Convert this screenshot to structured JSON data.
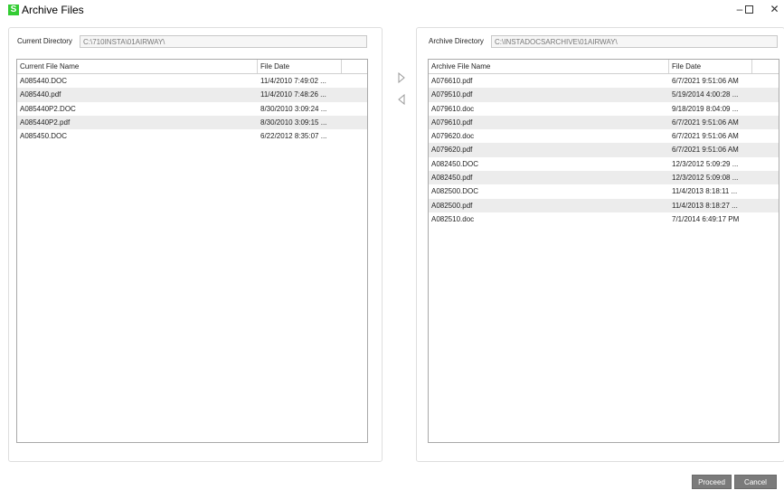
{
  "window": {
    "app_icon_letter": "S",
    "title": "Archive Files",
    "minimize_glyph": "–",
    "close_glyph": "✕"
  },
  "current_panel": {
    "directory_label": "Current Directory",
    "directory_value": "C:\\710INSTA\\01AIRWAY\\",
    "columns": [
      "Current File Name",
      "File Date"
    ],
    "rows": [
      {
        "name": "A085440.DOC",
        "date": "11/4/2010 7:49:02 ..."
      },
      {
        "name": "A085440.pdf",
        "date": "11/4/2010 7:48:26 ..."
      },
      {
        "name": "A085440P2.DOC",
        "date": "8/30/2010 3:09:24 ..."
      },
      {
        "name": "A085440P2.pdf",
        "date": "8/30/2010 3:09:15 ..."
      },
      {
        "name": "A085450.DOC",
        "date": "6/22/2012 8:35:07 ..."
      }
    ]
  },
  "archive_panel": {
    "directory_label": "Archive Directory",
    "directory_value": "C:\\INSTADOCSARCHIVE\\01AIRWAY\\",
    "columns": [
      "Archive File Name",
      "File Date"
    ],
    "rows": [
      {
        "name": "A076610.pdf",
        "date": "6/7/2021 9:51:06 AM"
      },
      {
        "name": "A079510.pdf",
        "date": "5/19/2014 4:00:28 ..."
      },
      {
        "name": "A079610.doc",
        "date": "9/18/2019 8:04:09 ..."
      },
      {
        "name": "A079610.pdf",
        "date": "6/7/2021 9:51:06 AM"
      },
      {
        "name": "A079620.doc",
        "date": "6/7/2021 9:51:06 AM"
      },
      {
        "name": "A079620.pdf",
        "date": "6/7/2021 9:51:06 AM"
      },
      {
        "name": "A082450.DOC",
        "date": "12/3/2012 5:09:29 ..."
      },
      {
        "name": "A082450.pdf",
        "date": "12/3/2012 5:09:08 ..."
      },
      {
        "name": "A082500.DOC",
        "date": "11/4/2013 8:18:11 ..."
      },
      {
        "name": "A082500.pdf",
        "date": "11/4/2013 8:18:27 ..."
      },
      {
        "name": "A082510.doc",
        "date": "7/1/2014 6:49:17 PM"
      }
    ]
  },
  "transfer": {
    "move_to_archive_icon": "triangle-right-icon",
    "move_to_current_icon": "triangle-left-icon"
  },
  "buttons": {
    "proceed": "Proceed",
    "cancel": "Cancel"
  },
  "colors": {
    "app_icon": "#33cc33",
    "alt_row": "#ececec",
    "button_bg": "#7b7b7b"
  }
}
